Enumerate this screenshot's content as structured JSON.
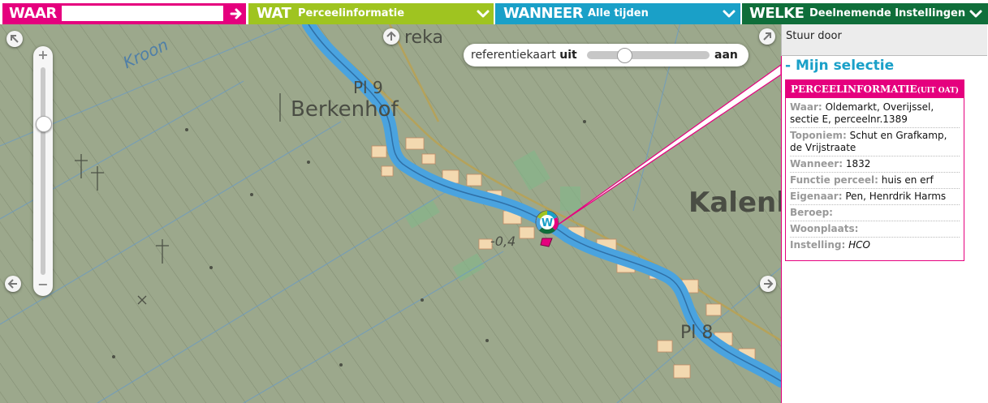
{
  "filters": {
    "waar": {
      "key": "WAAR",
      "value": "",
      "placeholder": ""
    },
    "wat": {
      "key": "WAT",
      "value": "Perceelinformatie"
    },
    "wanneer": {
      "key": "WANNEER",
      "value": "Alle tijden"
    },
    "welke": {
      "key": "WELKE",
      "value": "Deelnemende Instellingen"
    }
  },
  "map": {
    "labels": {
      "reka": "reka",
      "pl9": "Pl 9",
      "berkenhof": "Berkenhof",
      "kroon": "Kroon",
      "kalen": "Kalenl",
      "pl8": "Pl 8",
      "minus04": "-0,4"
    },
    "reference_map": {
      "label": "referentiekaart",
      "off_label": "uit",
      "on_label": "aan",
      "state": "uit"
    },
    "zoom": {
      "plus": "+",
      "minus": "−",
      "level": 0.27
    },
    "marker_letter": "W"
  },
  "panel": {
    "forward_label": "Stuur door",
    "selection_title": "- Mijn selectie",
    "info": {
      "header": "PERCEELINFORMATIE",
      "header_source": "(UIT OAT)",
      "rows": [
        {
          "key": "Waar:",
          "value": "Oldemarkt, Overijssel, sectie E, perceelnr.1389"
        },
        {
          "key": "Toponiem:",
          "value": "Schut en Grafkamp, de Vrijstraate"
        },
        {
          "key": "Wanneer:",
          "value": "1832"
        },
        {
          "key": "Functie perceel:",
          "value": "huis en erf"
        },
        {
          "key": "Eigenaar:",
          "value": "Pen, Henrdrik Harms"
        },
        {
          "key": "Beroep:",
          "value": ""
        },
        {
          "key": "Woonplaats:",
          "value": ""
        },
        {
          "key": "Instelling:",
          "value": "HCO"
        }
      ]
    }
  },
  "colors": {
    "waar": "#e5007e",
    "wat": "#9fc420",
    "wanneer": "#1aa0c8",
    "welke": "#0f6e3a",
    "water": "#4aa3df",
    "map_base": "#9aa58a"
  },
  "icons": [
    "arrow-right-icon",
    "chevron-down-icon",
    "pan-arrow-icon",
    "map-marker-icon"
  ]
}
